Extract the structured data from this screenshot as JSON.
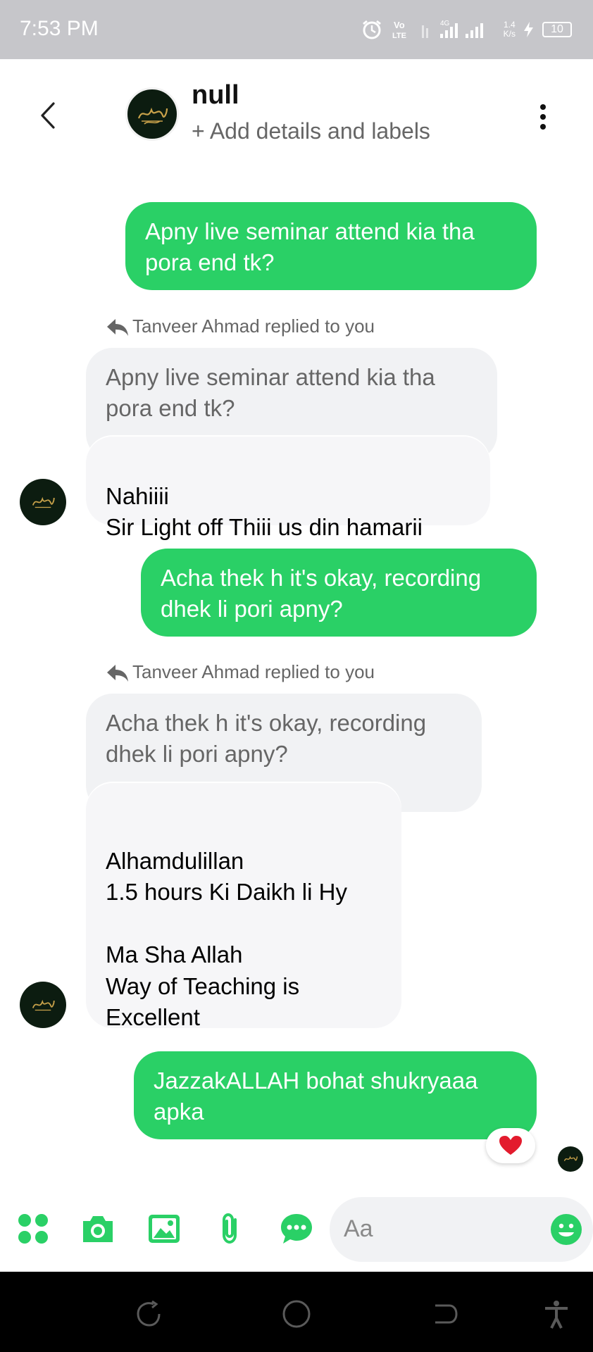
{
  "status_bar": {
    "time": "7:53 PM",
    "net_speed_top": "1.4",
    "net_speed_bottom": "K/s",
    "battery": "10"
  },
  "header": {
    "contact_name": "null",
    "subtitle": "+ Add details and labels"
  },
  "messages": [
    {
      "direction": "outgoing",
      "text": "Apny live seminar attend kia tha pora end tk?"
    },
    {
      "direction": "incoming",
      "reply_label": "Tanveer Ahmad replied to you",
      "quoted": "Apny live seminar attend kia tha pora end tk?",
      "text": "Nahiiii\nSir Light off Thiii us din hamarii"
    },
    {
      "direction": "outgoing",
      "text": "Acha thek h it's okay, recording dhek li pori apny?"
    },
    {
      "direction": "incoming",
      "reply_label": "Tanveer Ahmad replied to you",
      "quoted": "Acha thek h it's okay, recording dhek li pori apny?",
      "text": "Alhamdulillan\n1.5 hours Ki Daikh li Hy\n\nMa Sha Allah\nWay of Teaching is\nExcellent"
    },
    {
      "direction": "outgoing",
      "text": "JazzakALLAH bohat shukryaaa apka",
      "reaction": "heart"
    }
  ],
  "composer": {
    "placeholder": "Aa",
    "tools": [
      "apps-icon",
      "camera-icon",
      "gallery-icon",
      "attachment-icon",
      "chat-bubble-icon"
    ]
  },
  "colors": {
    "accent": "#2ad066",
    "incoming_bubble": "#f6f6f8",
    "quoted_bubble": "#f1f2f4",
    "status_bar": "#c6c6ca",
    "nav_bar": "#000000"
  }
}
